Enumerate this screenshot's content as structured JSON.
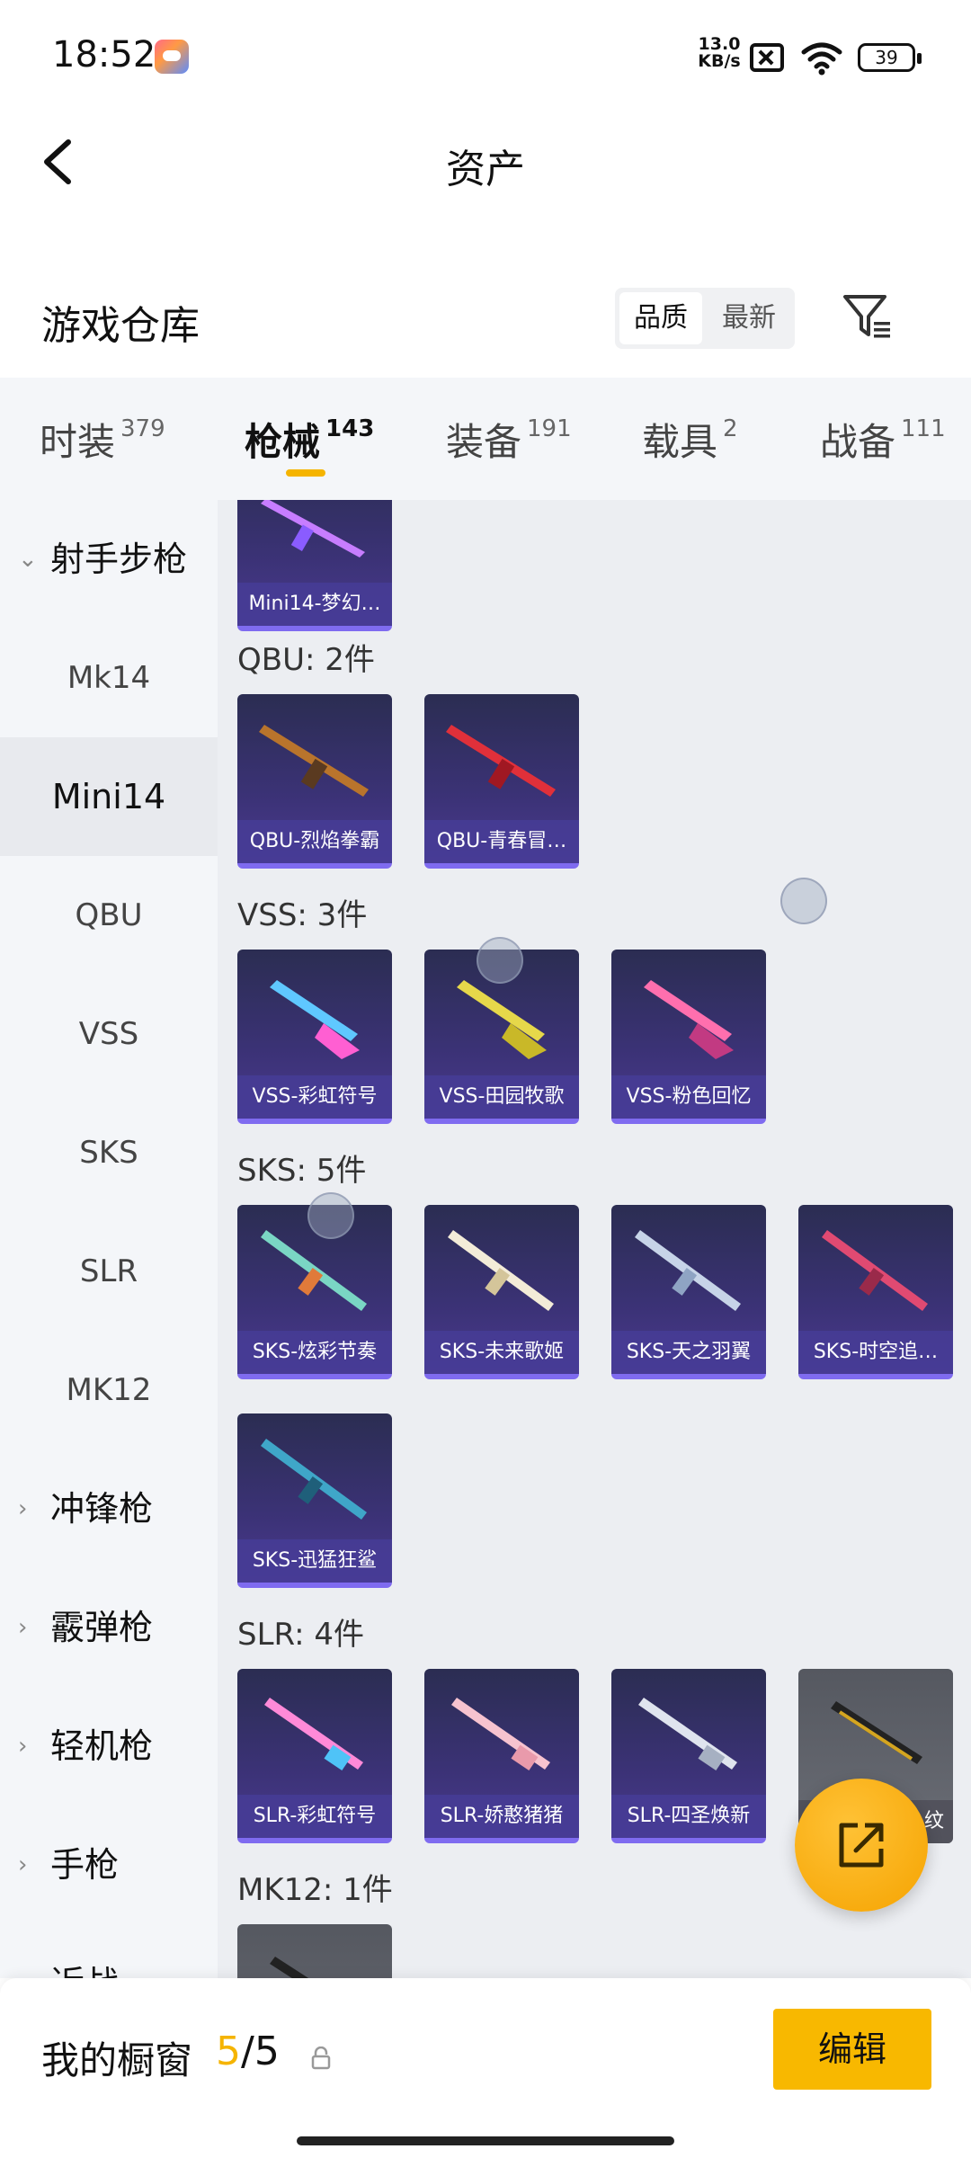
{
  "status_bar": {
    "time": "18:52",
    "net_speed_value": "13.0",
    "net_speed_unit": "KB/s",
    "battery": "39"
  },
  "header": {
    "title": "资产"
  },
  "warehouse": {
    "title": "游戏仓库",
    "sort_options": [
      "品质",
      "最新"
    ]
  },
  "tabs": [
    {
      "label": "时装",
      "count": "379"
    },
    {
      "label": "枪械",
      "count": "143",
      "active": true
    },
    {
      "label": "装备",
      "count": "191"
    },
    {
      "label": "载具",
      "count": "2"
    },
    {
      "label": "战备",
      "count": "111"
    }
  ],
  "sidebar": {
    "group_open": "射手步枪",
    "subitems": [
      "Mk14",
      "Mini14",
      "QBU",
      "VSS",
      "SKS",
      "SLR",
      "MK12"
    ],
    "selected": "Mini14",
    "groups_closed": [
      "冲锋枪",
      "霰弹枪",
      "轻机枪",
      "手枪",
      "近战"
    ]
  },
  "sections": [
    {
      "label": "",
      "items": [
        {
          "name": "Mini14-梦幻…"
        }
      ]
    },
    {
      "label": "QBU: 2件",
      "items": [
        {
          "name": "QBU-烈焰拳霸"
        },
        {
          "name": "QBU-青春冒…"
        }
      ]
    },
    {
      "label": "VSS: 3件",
      "items": [
        {
          "name": "VSS-彩虹符号"
        },
        {
          "name": "VSS-田园牧歌"
        },
        {
          "name": "VSS-粉色回忆"
        }
      ]
    },
    {
      "label": "SKS: 5件",
      "items": [
        {
          "name": "SKS-炫彩节奏"
        },
        {
          "name": "SKS-未来歌姬"
        },
        {
          "name": "SKS-天之羽翼"
        },
        {
          "name": "SKS-时空追…"
        },
        {
          "name": "SKS-迅猛狂鲨"
        }
      ]
    },
    {
      "label": "SLR: 4件",
      "items": [
        {
          "name": "SLR-彩虹符号"
        },
        {
          "name": "SLR-娇憨猪猪"
        },
        {
          "name": "SLR-四圣焕新"
        },
        {
          "name": "纹"
        }
      ]
    },
    {
      "label": "MK12: 1件",
      "items": []
    }
  ],
  "bottom": {
    "window_label": "我的橱窗",
    "window_current": "5",
    "window_total": "/5",
    "edit_label": "编辑"
  },
  "colors": {
    "accent": "#f8b800",
    "card_bg": "#3b3276",
    "card_border": "#7f6bf0"
  }
}
